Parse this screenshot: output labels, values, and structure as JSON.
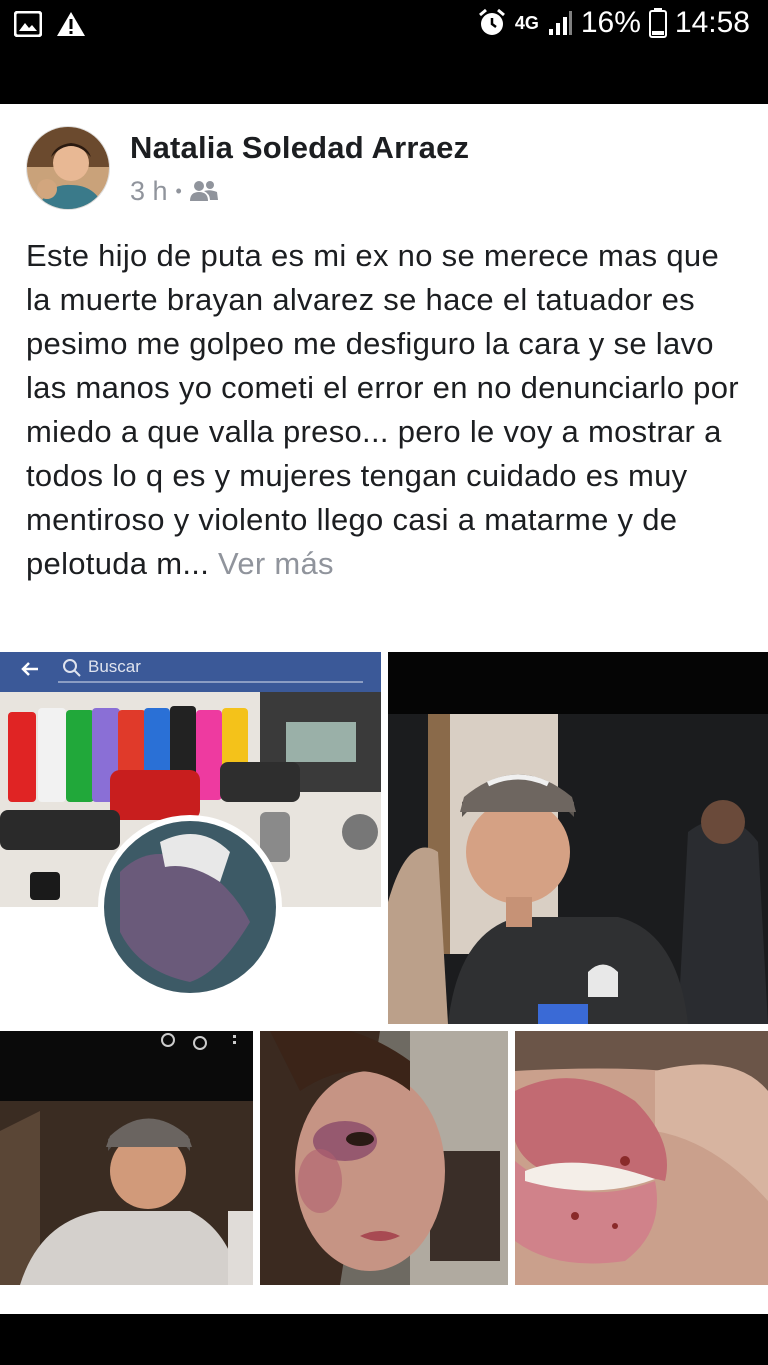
{
  "status_bar": {
    "network": "4G",
    "battery": "16%",
    "time": "14:58",
    "icons": [
      "image-icon",
      "warning-icon",
      "alarm-icon",
      "signal-icon",
      "battery-icon"
    ]
  },
  "post": {
    "author": "Natalia Soledad Arraez",
    "time": "3 h",
    "separator": "•",
    "audience_icon": "friends-icon",
    "body": "Este hijo de puta es mi ex no se merece mas que la muerte brayan alvarez se hace el tatuador es pesimo me golpeo me desfiguro la cara  y se lavo las manos yo cometi el error en no denunciarlo por miedo a que valla preso... pero le voy a mostrar a todos lo q es y mujeres tengan cuidado es muy mentiroso y violento llego casi a matarme y de pelotuda m...",
    "see_more": "Ver más"
  },
  "photos": {
    "screenshot_search": "Buscar",
    "screenshot_back_icon": "back-arrow-icon",
    "screenshot_search_icon": "search-icon"
  },
  "colors": {
    "facebook_blue": "#3b5998",
    "meta_gray": "#90949c",
    "text_dark": "#1c1e21"
  }
}
